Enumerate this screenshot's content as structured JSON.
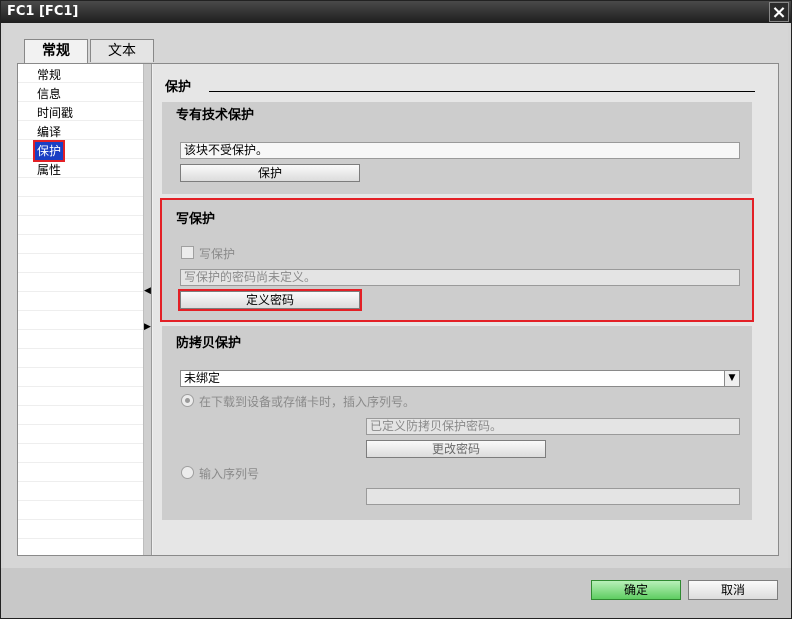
{
  "window": {
    "title": "FC1 [FC1]",
    "close_icon": "×"
  },
  "tabs": [
    {
      "label": "常规",
      "active": true
    },
    {
      "label": "文本",
      "active": false
    }
  ],
  "nav": {
    "items": [
      {
        "label": "常规"
      },
      {
        "label": "信息"
      },
      {
        "label": "时间戳"
      },
      {
        "label": "编译"
      },
      {
        "label": "保护",
        "selected": true
      },
      {
        "label": "属性"
      }
    ]
  },
  "main": {
    "heading": "保护",
    "know_how": {
      "title": "专有技术保护",
      "status": "该块不受保护。",
      "button": "保护"
    },
    "write_protect": {
      "title": "写保护",
      "checkbox_label": "写保护",
      "status": "写保护的密码尚未定义。",
      "button": "定义密码"
    },
    "copy_protect": {
      "title": "防拷贝保护",
      "select_value": "未绑定",
      "option1": "在下载到设备或存储卡时，插入序列号。",
      "password_status": "已定义防拷贝保护密码。",
      "change_button": "更改密码",
      "option2": "输入序列号",
      "serial_value": ""
    }
  },
  "footer": {
    "ok": "确定",
    "cancel": "取消"
  },
  "colors": {
    "accent_red": "#e32026",
    "selection_blue": "#1a3fc4",
    "ok_green": "#5fcd62"
  }
}
